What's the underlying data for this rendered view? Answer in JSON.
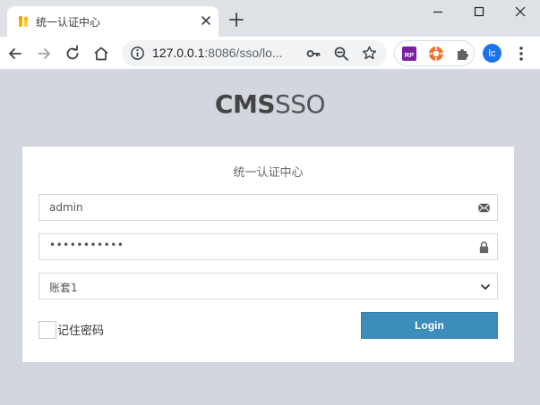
{
  "browser": {
    "tab": {
      "title": "统一认证中心"
    },
    "address": {
      "host": "127.0.0.1",
      "rest": ":8086/sso/lo..."
    },
    "profile_initials": "lc",
    "ext_badge": "RP"
  },
  "page": {
    "logo": {
      "bold": "CMS",
      "light": "SSO"
    },
    "card_title": "统一认证中心",
    "username": {
      "value": "admin"
    },
    "password": {
      "masked": "•••••••••••"
    },
    "account_set": {
      "selected": "账套1"
    },
    "remember_label": "记住密码",
    "login_label": "Login"
  },
  "colors": {
    "page_bg": "#d2d6de",
    "primary": "#3c8dbc"
  }
}
